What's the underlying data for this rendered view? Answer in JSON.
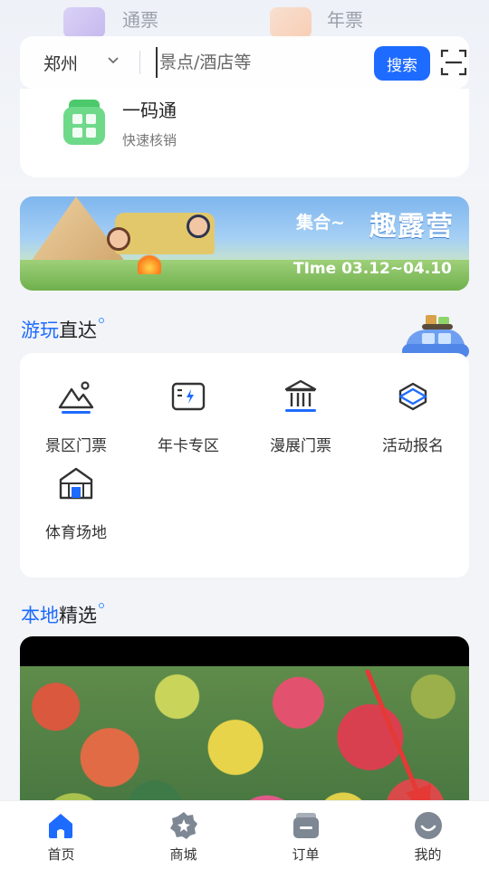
{
  "ticket_row": {
    "items": [
      {
        "label": "通票",
        "icon": "ticket-purple-icon"
      },
      {
        "label": "年票",
        "icon": "ticket-orange-icon"
      }
    ]
  },
  "search": {
    "city": "郑州",
    "placeholder": "景点/酒店等",
    "button_label": "搜索",
    "scan_icon": "scan-icon"
  },
  "one_code": {
    "title": "一码通",
    "subtitle": "快速核销",
    "icon": "qr-code-icon"
  },
  "banner": {
    "title_prefix": "集合~",
    "title_main": "趣露营",
    "date_text": "TIme 03.12~04.10"
  },
  "play_section": {
    "title_highlight": "游玩",
    "title_rest": "直达",
    "items": [
      {
        "label": "景区门票",
        "icon": "mountain-icon"
      },
      {
        "label": "年卡专区",
        "icon": "card-lightning-icon"
      },
      {
        "label": "漫展门票",
        "icon": "museum-icon"
      },
      {
        "label": "活动报名",
        "icon": "boxing-ring-icon"
      },
      {
        "label": "体育场地",
        "icon": "stadium-icon"
      }
    ]
  },
  "local_section": {
    "title_highlight": "本地",
    "title_rest": "精选"
  },
  "bottom_nav": {
    "items": [
      {
        "label": "首页",
        "icon": "home-icon",
        "active": true
      },
      {
        "label": "商城",
        "icon": "mall-icon",
        "active": false
      },
      {
        "label": "订单",
        "icon": "order-icon",
        "active": false
      },
      {
        "label": "我的",
        "icon": "profile-icon",
        "active": false
      }
    ]
  },
  "colors": {
    "accent": "#1e6bff",
    "card": "#ffffff",
    "background": "#f2f4f8",
    "annotation": "#e53935"
  }
}
